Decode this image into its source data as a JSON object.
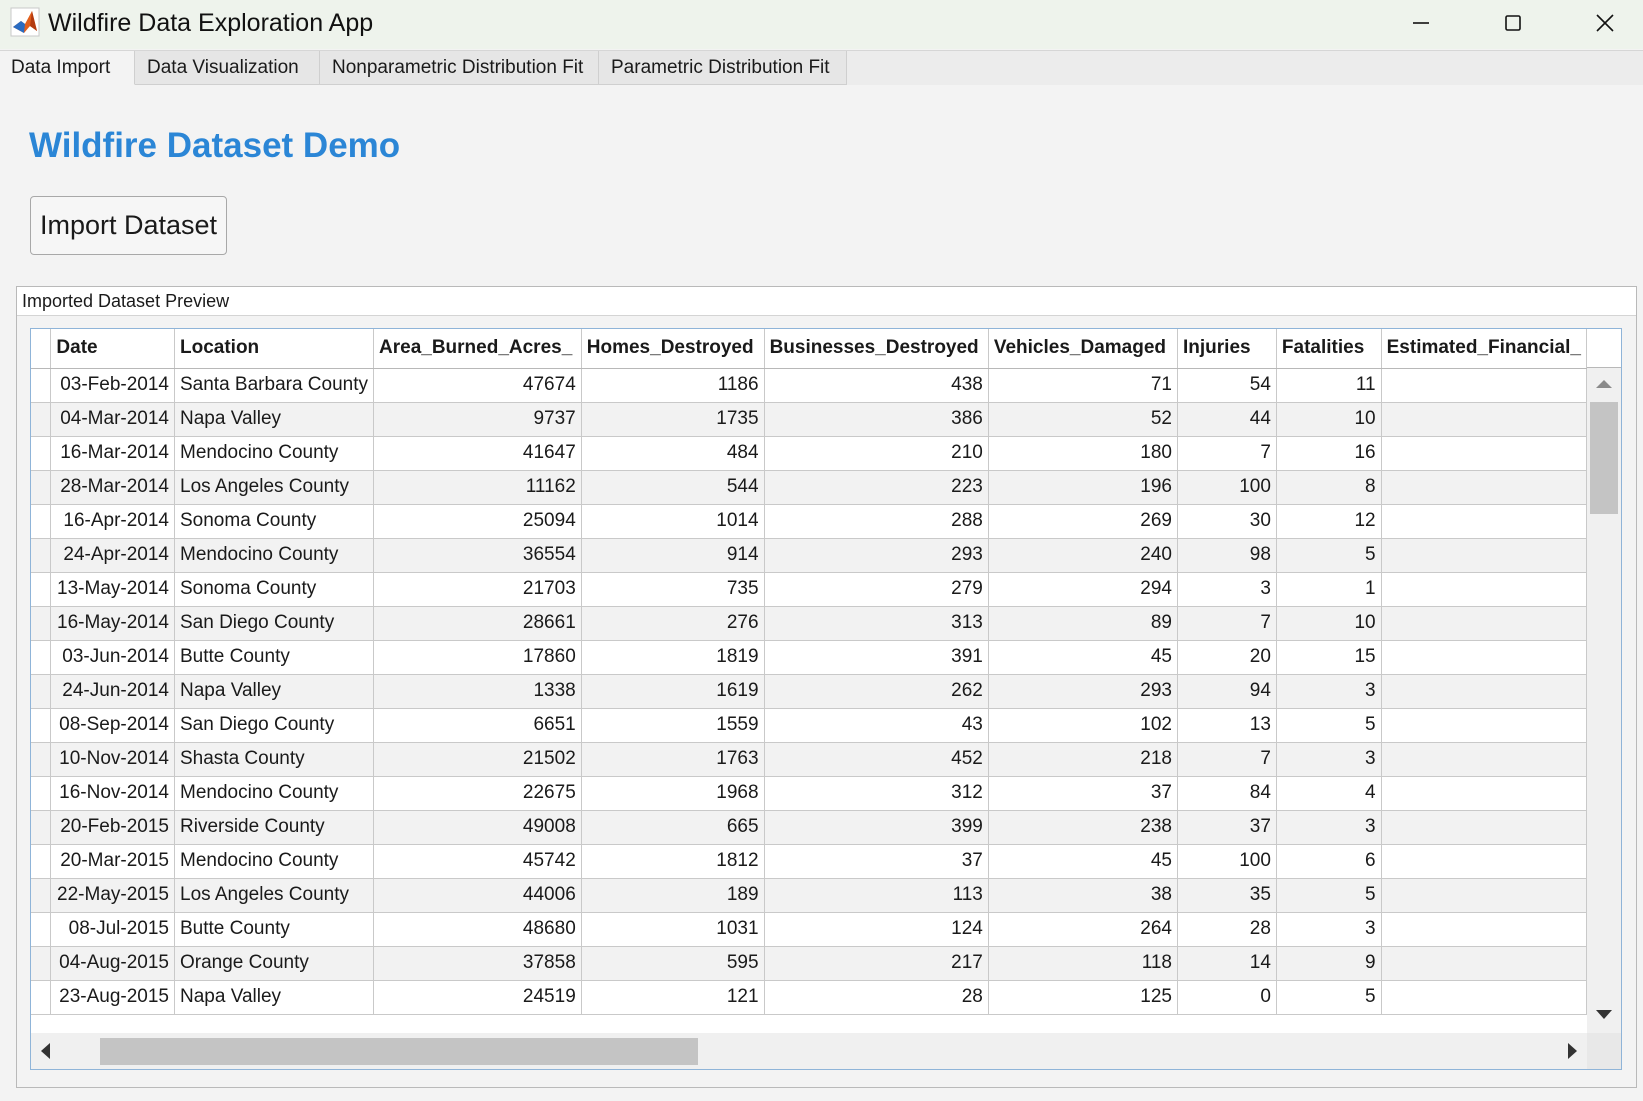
{
  "window": {
    "title": "Wildfire Data Exploration App",
    "icon": "matlab-icon",
    "controls": [
      "minimize-icon",
      "maximize-icon",
      "close-icon"
    ]
  },
  "tabs": [
    {
      "label": "Data Import",
      "active": true
    },
    {
      "label": "Data Visualization",
      "active": false
    },
    {
      "label": "Nonparametric Distribution Fit",
      "active": false
    },
    {
      "label": "Parametric Distribution Fit",
      "active": false
    }
  ],
  "main": {
    "title": "Wildfire Dataset Demo",
    "import_button": "Import Dataset",
    "title_color": "#2b86d6"
  },
  "panel": {
    "title": "Imported Dataset Preview"
  },
  "table": {
    "columns": [
      "Date",
      "Location",
      "Area_Burned_Acres_",
      "Homes_Destroyed",
      "Businesses_Destroyed",
      "Vehicles_Damaged",
      "Injuries",
      "Fatalities",
      "Estimated_Financial_"
    ],
    "rows": [
      [
        "03-Feb-2014",
        "Santa Barbara County",
        "47674",
        "1186",
        "438",
        "71",
        "54",
        "11",
        ""
      ],
      [
        "04-Mar-2014",
        "Napa Valley",
        "9737",
        "1735",
        "386",
        "52",
        "44",
        "10",
        ""
      ],
      [
        "16-Mar-2014",
        "Mendocino County",
        "41647",
        "484",
        "210",
        "180",
        "7",
        "16",
        ""
      ],
      [
        "28-Mar-2014",
        "Los Angeles County",
        "11162",
        "544",
        "223",
        "196",
        "100",
        "8",
        ""
      ],
      [
        "16-Apr-2014",
        "Sonoma County",
        "25094",
        "1014",
        "288",
        "269",
        "30",
        "12",
        ""
      ],
      [
        "24-Apr-2014",
        "Mendocino County",
        "36554",
        "914",
        "293",
        "240",
        "98",
        "5",
        ""
      ],
      [
        "13-May-2014",
        "Sonoma County",
        "21703",
        "735",
        "279",
        "294",
        "3",
        "1",
        ""
      ],
      [
        "16-May-2014",
        "San Diego County",
        "28661",
        "276",
        "313",
        "89",
        "7",
        "10",
        ""
      ],
      [
        "03-Jun-2014",
        "Butte County",
        "17860",
        "1819",
        "391",
        "45",
        "20",
        "15",
        ""
      ],
      [
        "24-Jun-2014",
        "Napa Valley",
        "1338",
        "1619",
        "262",
        "293",
        "94",
        "3",
        ""
      ],
      [
        "08-Sep-2014",
        "San Diego County",
        "6651",
        "1559",
        "43",
        "102",
        "13",
        "5",
        ""
      ],
      [
        "10-Nov-2014",
        "Shasta County",
        "21502",
        "1763",
        "452",
        "218",
        "7",
        "3",
        ""
      ],
      [
        "16-Nov-2014",
        "Mendocino County",
        "22675",
        "1968",
        "312",
        "37",
        "84",
        "4",
        ""
      ],
      [
        "20-Feb-2015",
        "Riverside County",
        "49008",
        "665",
        "399",
        "238",
        "37",
        "3",
        ""
      ],
      [
        "20-Mar-2015",
        "Mendocino County",
        "45742",
        "1812",
        "37",
        "45",
        "100",
        "6",
        ""
      ],
      [
        "22-May-2015",
        "Los Angeles County",
        "44006",
        "189",
        "113",
        "38",
        "35",
        "5",
        ""
      ],
      [
        "08-Jul-2015",
        "Butte County",
        "48680",
        "1031",
        "124",
        "264",
        "28",
        "3",
        ""
      ],
      [
        "04-Aug-2015",
        "Orange County",
        "37858",
        "595",
        "217",
        "118",
        "14",
        "9",
        ""
      ],
      [
        "23-Aug-2015",
        "Napa Valley",
        "24519",
        "121",
        "28",
        "125",
        "0",
        "5",
        ""
      ]
    ]
  },
  "scroll": {
    "vertical_position": 0.0,
    "horizontal_position": 0.0
  }
}
